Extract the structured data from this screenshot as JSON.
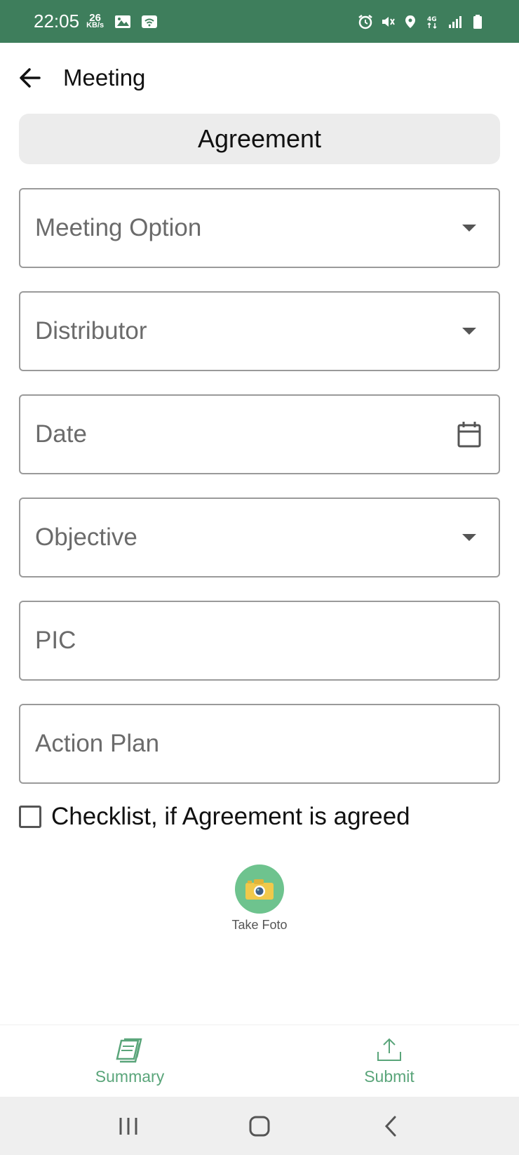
{
  "status_bar": {
    "time": "22:05",
    "speed_value": "26",
    "speed_unit": "KB/s"
  },
  "header": {
    "title": "Meeting"
  },
  "section": {
    "title": "Agreement"
  },
  "form": {
    "meeting_option": "Meeting Option",
    "distributor": "Distributor",
    "date": "Date",
    "objective": "Objective",
    "pic": "PIC",
    "action_plan": "Action Plan",
    "checklist_label": "Checklist, if Agreement is agreed",
    "take_foto_label": "Take Foto"
  },
  "bottom_nav": {
    "summary": "Summary",
    "submit": "Submit"
  },
  "colors": {
    "status_bar": "#3e7e5c",
    "accent": "#5aa57a"
  }
}
